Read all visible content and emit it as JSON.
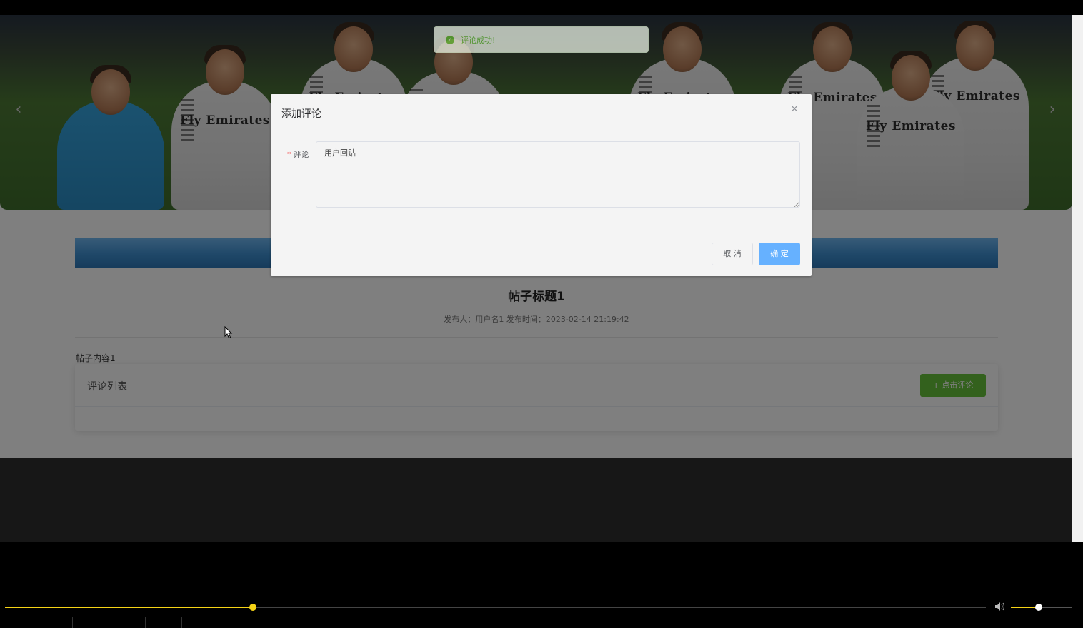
{
  "toast": {
    "message": "评论成功!",
    "type": "success",
    "icon": "check-circle-icon",
    "color": "#67c23a"
  },
  "dialog": {
    "title": "添加评论",
    "close_icon": "close-icon",
    "field_label": "评论",
    "required_mark": "*",
    "textarea_value": "用户回贴",
    "cancel_label": "取 消",
    "confirm_label": "确 定",
    "confirm_color": "#66b1ff"
  },
  "post": {
    "title": "帖子标题1",
    "meta": "发布人：用户名1  发布时间：2023-02-14 21:19:42",
    "body": "帖子内容1"
  },
  "comments": {
    "header": "评论列表",
    "add_button_label": "+ 点击评论",
    "add_button_color": "#67c23a"
  },
  "banner": {
    "sponsor_text": "Fly Emirates",
    "prev_icon": "chevron-left-icon",
    "next_icon": "chevron-right-icon"
  },
  "media_player": {
    "progress": 0.253,
    "volume": 0.45,
    "accent_color": "#f5d316",
    "volume_icon": "speaker-icon"
  }
}
